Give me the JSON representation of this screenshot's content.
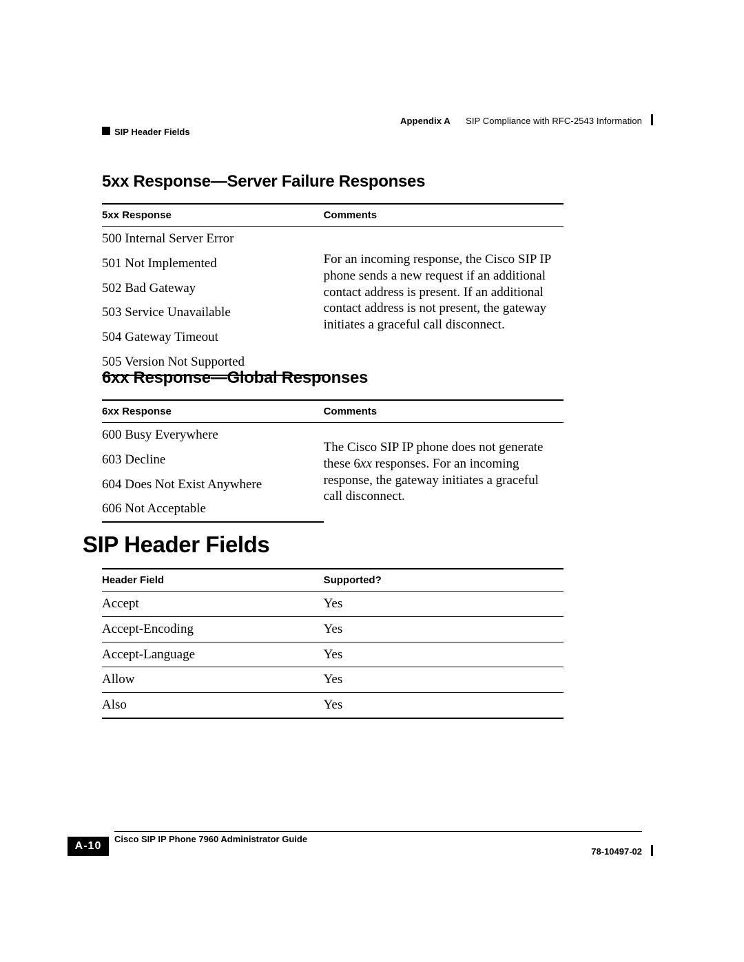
{
  "runhead": {
    "appendix": "Appendix A",
    "title": "SIP Compliance with RFC-2543 Information",
    "section": "SIP Header Fields"
  },
  "sections": {
    "s5xx": {
      "heading": "5xx Response—Server Failure Responses",
      "col1": "5xx Response",
      "col2": "Comments",
      "rows": [
        "500 Internal Server Error",
        "501 Not Implemented",
        "502 Bad Gateway",
        "503 Service Unavailable",
        "504 Gateway Timeout",
        "505 Version Not Supported"
      ],
      "comment": "For an incoming response, the Cisco SIP IP phone sends a new request if an additional contact address is present. If an additional contact address is not present, the gateway initiates a graceful call disconnect."
    },
    "s6xx": {
      "heading": "6xx Response—Global Responses",
      "col1": "6xx Response",
      "col2": "Comments",
      "rows": [
        "600 Busy Everywhere",
        "603 Decline",
        "604 Does Not Exist Anywhere",
        "606 Not Acceptable"
      ],
      "comment_pre": "The Cisco SIP IP phone does not generate these 6",
      "comment_ital": "xx",
      "comment_post": " responses. For an incoming response, the gateway initiates a graceful call disconnect."
    },
    "headerFields": {
      "heading": "SIP Header Fields",
      "col1": "Header Field",
      "col2": "Supported?",
      "rows": [
        {
          "field": "Accept",
          "supported": "Yes"
        },
        {
          "field": "Accept-Encoding",
          "supported": "Yes"
        },
        {
          "field": "Accept-Language",
          "supported": "Yes"
        },
        {
          "field": "Allow",
          "supported": "Yes"
        },
        {
          "field": "Also",
          "supported": "Yes"
        }
      ]
    }
  },
  "runfoot": {
    "guide": "Cisco SIP IP Phone 7960 Administrator Guide",
    "docnum": "78-10497-02",
    "pagenum": "A-10"
  }
}
